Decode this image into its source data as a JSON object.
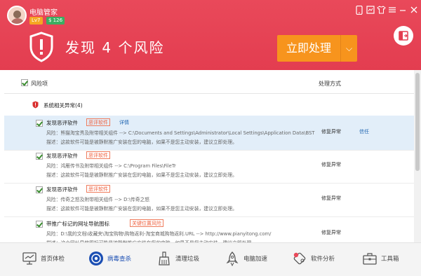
{
  "header": {
    "app_title": "电脑管家",
    "level_badge": "Lv7",
    "coin_badge": "$ 126",
    "headline": "发现 4 个风险",
    "fix_button": "立即处理",
    "fix_arrow": "⌵",
    "accent_color": "#e9495a",
    "button_color": "#f7941d"
  },
  "title_bar_icons": [
    "phone-icon",
    "skin-icon",
    "shirt-icon",
    "settings-icon",
    "minimize-icon",
    "close-icon"
  ],
  "columns": {
    "risk": "风险项",
    "method": "处理方式"
  },
  "group": {
    "title": "系统相关异常(4)"
  },
  "items": [
    {
      "title": "发现恶评软件",
      "tag": "恶评软件",
      "detail": "详情",
      "risk_line": "风险：熊猫淘宝秀及附带相关组件 --> C:\\Documents and Settings\\Administrator\\Local Settings\\Application Data\\BST",
      "desc_line": "描述：这款软件可能是被静默推广安装在您的电脑，如果不是您主动安装，建议立即处理。",
      "fix": "修复异常",
      "trust": "信任"
    },
    {
      "title": "发现恶评软件",
      "tag": "恶评软件",
      "risk_line": "风险：鸿雁传书及附带相关组件 --> C:\\Program Files\\FileTr",
      "desc_line": "描述：这款软件可能是被静默推广安装在您的电脑，如果不是您主动安装，建议立即处理。",
      "fix": "修复异常"
    },
    {
      "title": "发现恶评软件",
      "tag": "恶评软件",
      "risk_line": "风险：传奇之怒及附带相关组件 --> D:\\传奇之怒",
      "desc_line": "描述：这款软件可能是被静默推广安装在您的电脑，如果不是您主动安装，建议立即处理。",
      "fix": "修复异常"
    },
    {
      "title": "带推广标记的网址导航图标",
      "tag": "关键位置风险",
      "risk_line": "风险：D:\\我的文档\\收藏夹\\淘宝购物\\购物返利-淘宝商城购物返利.URL --> http://www.pianyitong.com/",
      "desc_line": "描述：这个网址导航图标可能是被静默推广安装在您的电脑，如果不是您主动安装，建议立即处理。",
      "fix": "修复异常"
    }
  ],
  "bottom_nav": [
    {
      "label": "首页体检",
      "icon": "monitor-icon"
    },
    {
      "label": "病毒查杀",
      "icon": "virus-scan-icon"
    },
    {
      "label": "清理垃圾",
      "icon": "broom-icon"
    },
    {
      "label": "电脑加速",
      "icon": "rocket-icon"
    },
    {
      "label": "软件分析",
      "icon": "software-icon"
    },
    {
      "label": "工具箱",
      "icon": "toolbox-icon"
    }
  ]
}
